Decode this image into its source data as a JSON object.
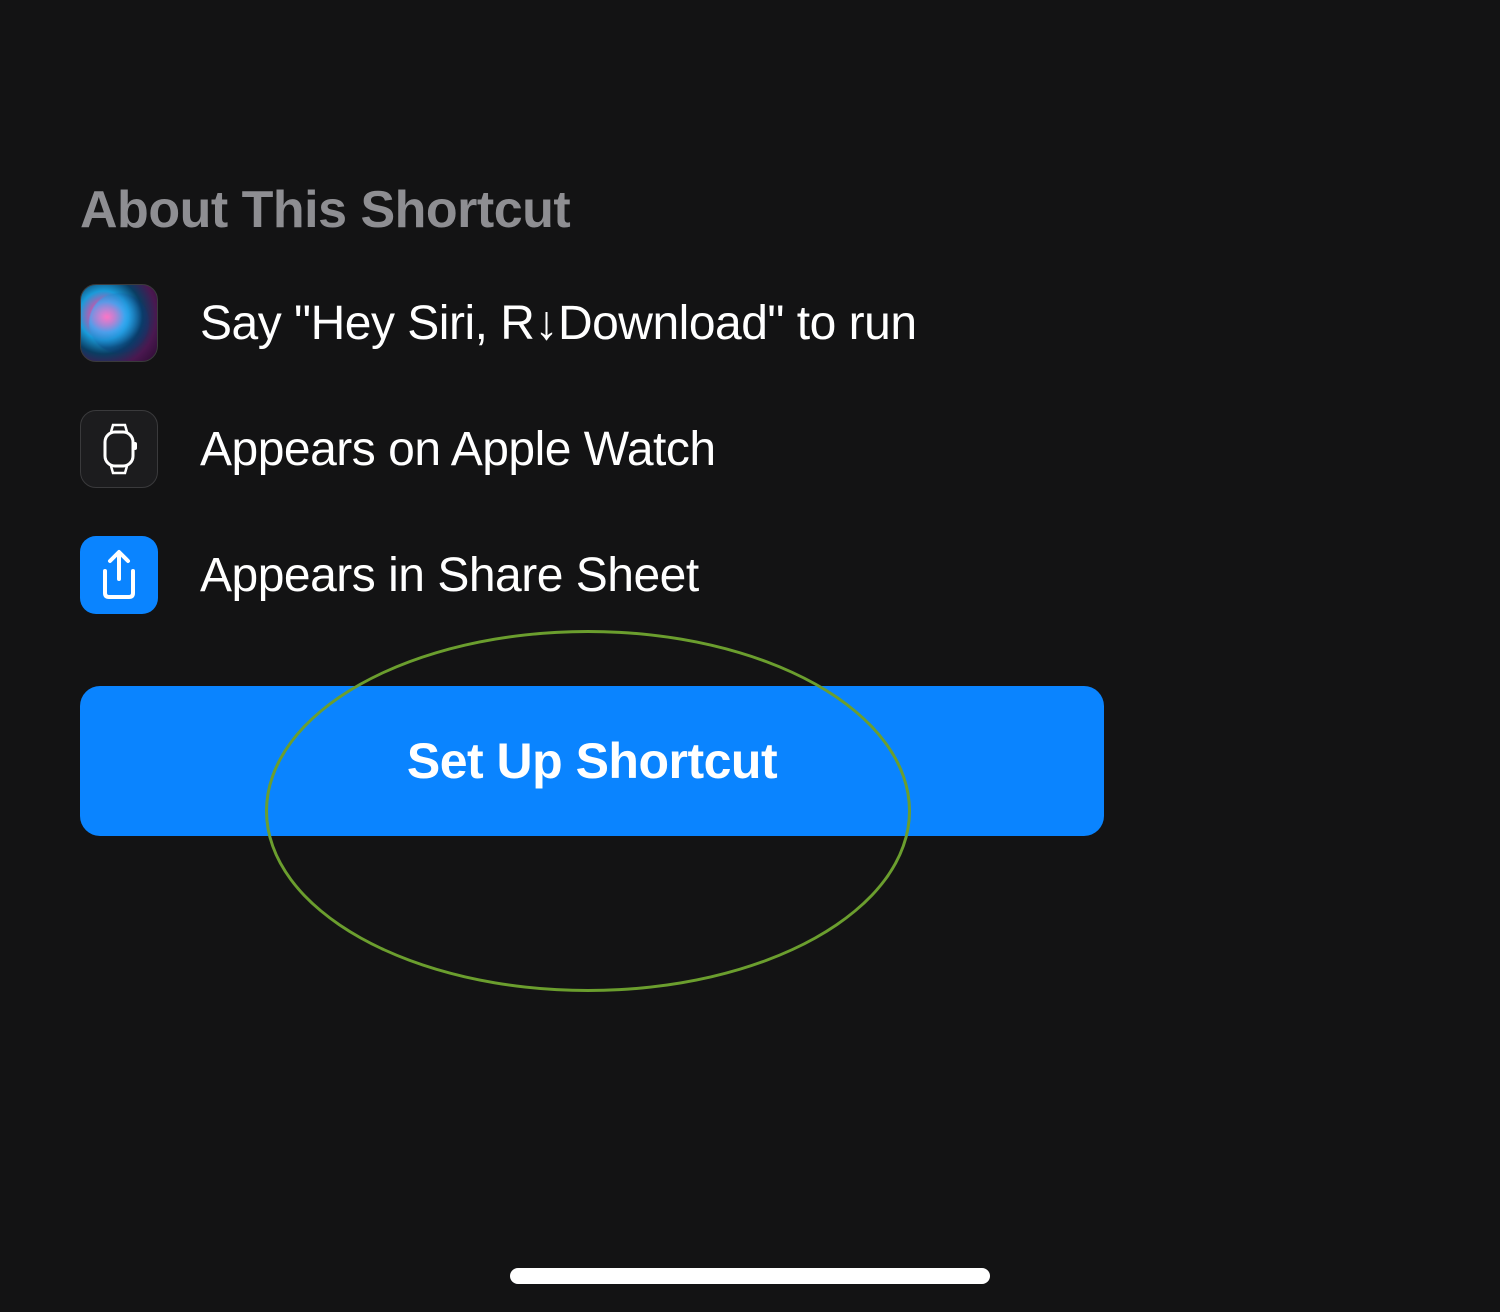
{
  "section": {
    "title": "About This Shortcut",
    "items": [
      {
        "icon": "siri-icon",
        "text": "Say \"Hey Siri, R↓Download\" to run"
      },
      {
        "icon": "apple-watch-icon",
        "text": "Appears on Apple Watch"
      },
      {
        "icon": "share-icon",
        "text": "Appears in Share Sheet"
      }
    ]
  },
  "button": {
    "setup_label": "Set Up Shortcut"
  },
  "colors": {
    "accent": "#0a84ff",
    "annotation": "#6b9e2e",
    "background": "#131314"
  }
}
